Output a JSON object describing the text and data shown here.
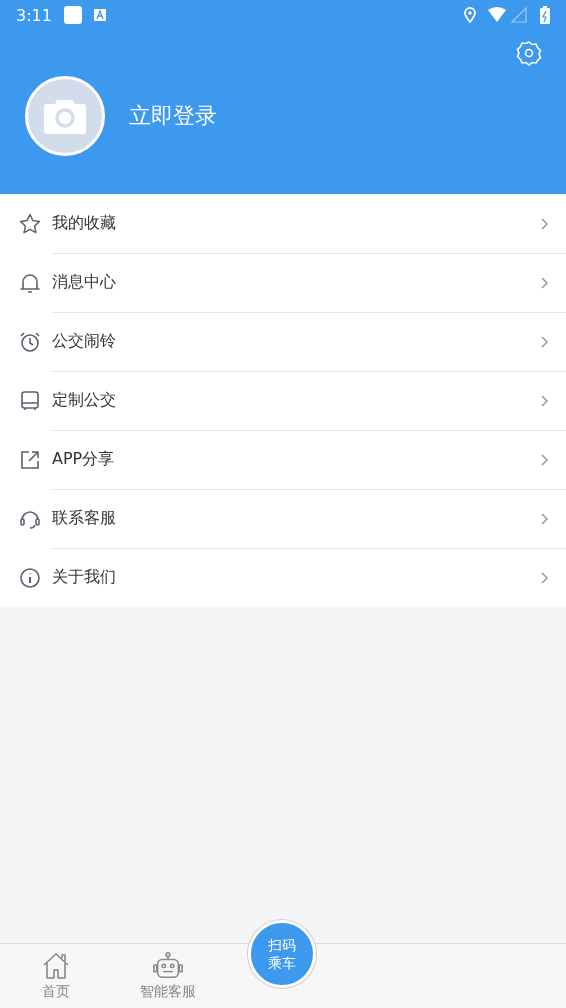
{
  "status_bar": {
    "time": "3:11"
  },
  "header": {
    "login": "立即登录"
  },
  "menu": [
    {
      "kind": "star",
      "label": "我的收藏"
    },
    {
      "kind": "bell",
      "label": "消息中心"
    },
    {
      "kind": "alarm",
      "label": "公交闹铃"
    },
    {
      "kind": "bus",
      "label": "定制公交"
    },
    {
      "kind": "share",
      "label": "APP分享"
    },
    {
      "kind": "headset",
      "label": "联系客服"
    },
    {
      "kind": "info",
      "label": "关于我们"
    }
  ],
  "tab_bar": {
    "tabs": [
      {
        "kind": "home",
        "label": "首页"
      },
      {
        "kind": "robot",
        "label": "智能客服"
      }
    ],
    "scan_button": [
      "扫码",
      "乘车"
    ]
  }
}
